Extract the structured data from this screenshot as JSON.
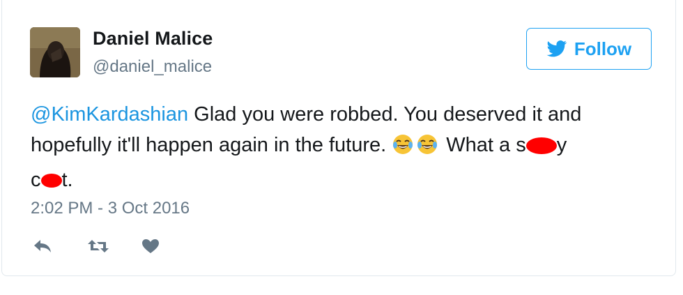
{
  "tweet": {
    "author": {
      "display_name": "Daniel Malice",
      "handle": "@daniel_malice",
      "avatar_icon": "user-avatar"
    },
    "follow_button": {
      "label": "Follow",
      "icon": "twitter-bird-icon",
      "color": "#1da1f2"
    },
    "text": {
      "mention": "@KimKardashian",
      "line1_rest": " Glad you were robbed. You deserved it and",
      "line2": "hopefully it'll happen again in the future. ",
      "emojis": [
        "face-with-tears-of-joy",
        "face-with-tears-of-joy"
      ],
      "line2_after": "What a s",
      "word_end": "y",
      "line3_start": "c",
      "line3_end": "t."
    },
    "timestamp": "2:02 PM - 3 Oct 2016",
    "actions": [
      "reply-icon",
      "retweet-icon",
      "like-icon"
    ],
    "colors": {
      "mention": "#1b95e0",
      "muted": "#657786",
      "redaction": "#ff0000"
    }
  }
}
